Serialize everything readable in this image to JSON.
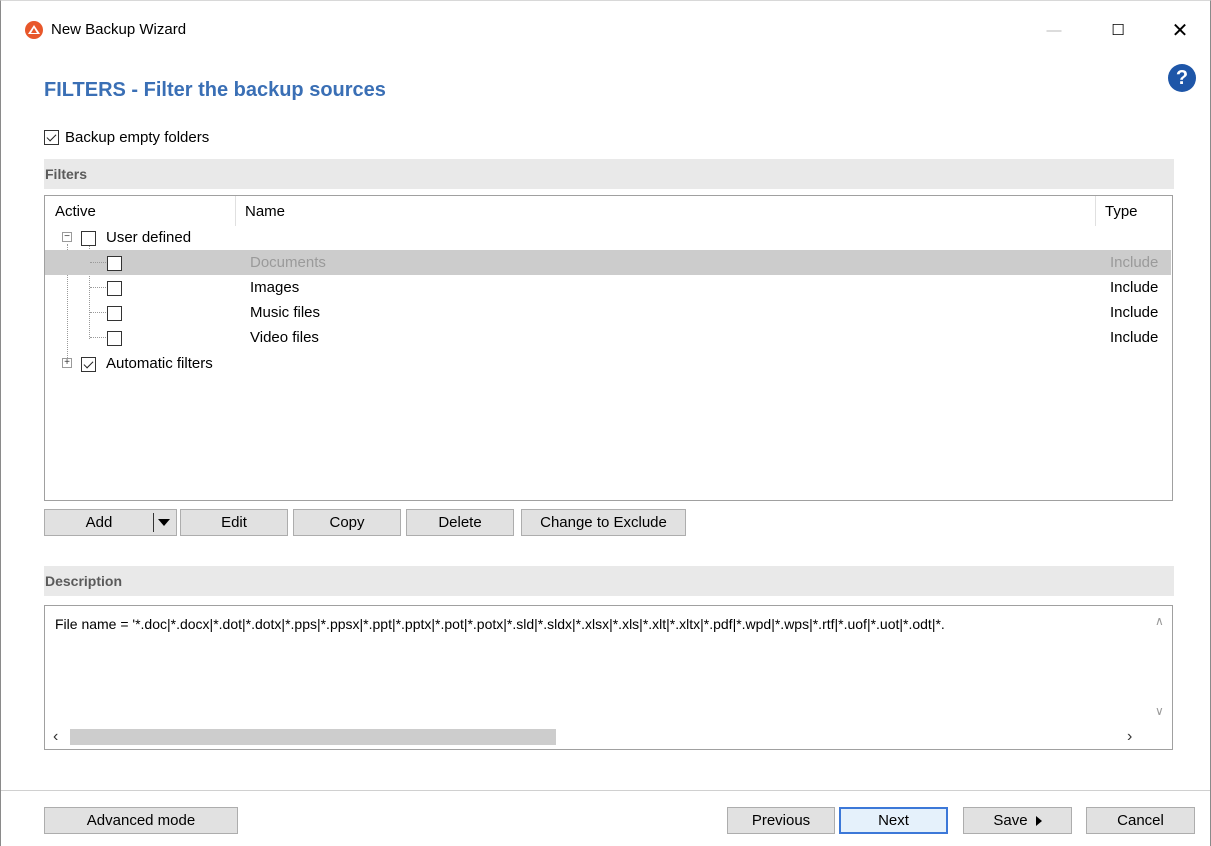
{
  "window": {
    "title": "New Backup Wizard",
    "minimize_glyph": "—",
    "maximize_glyph": "☐",
    "close_glyph": "✕"
  },
  "help_icon": "?",
  "page_title": "FILTERS - Filter the backup sources",
  "backup_empty_folders": {
    "label": "Backup empty folders",
    "checked": true
  },
  "filters_section": {
    "title": "Filters"
  },
  "tree": {
    "columns": {
      "active": "Active",
      "name": "Name",
      "type": "Type"
    },
    "groups": [
      {
        "label": "User defined",
        "checked": false,
        "expanded": true,
        "items": [
          {
            "name": "Documents",
            "type": "Include",
            "checked": false,
            "selected": true
          },
          {
            "name": "Images",
            "type": "Include",
            "checked": false,
            "selected": false
          },
          {
            "name": "Music files",
            "type": "Include",
            "checked": false,
            "selected": false
          },
          {
            "name": "Video files",
            "type": "Include",
            "checked": false,
            "selected": false
          }
        ]
      },
      {
        "label": "Automatic filters",
        "checked": true,
        "expanded": false,
        "items": []
      }
    ]
  },
  "tree_buttons": {
    "add": "Add",
    "edit": "Edit",
    "copy": "Copy",
    "delete": "Delete",
    "change": "Change to Exclude"
  },
  "description_section": {
    "title": "Description"
  },
  "description_text": "File name = '*.doc|*.docx|*.dot|*.dotx|*.pps|*.ppsx|*.ppt|*.pptx|*.pot|*.potx|*.sld|*.sldx|*.xlsx|*.xls|*.xlt|*.xltx|*.pdf|*.wpd|*.wps|*.rtf|*.uof|*.uot|*.odt|*.",
  "footer": {
    "advanced": "Advanced mode",
    "previous": "Previous",
    "next": "Next",
    "save": "Save",
    "cancel": "Cancel"
  },
  "colors": {
    "accent_title": "#3a6fb5",
    "help_blue": "#1e56a8",
    "app_icon": "#e8572a",
    "selected_row": "#cccccc"
  }
}
